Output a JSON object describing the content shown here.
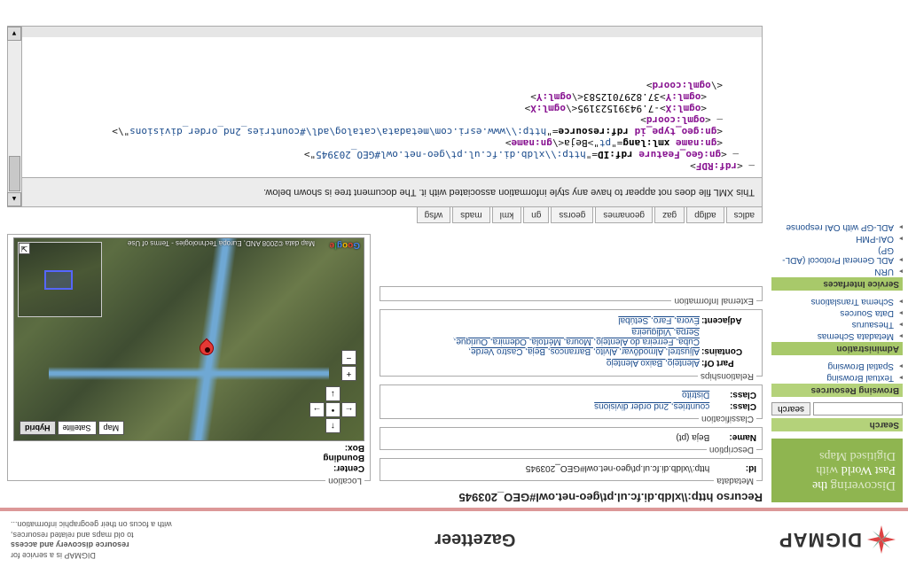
{
  "header": {
    "logo_text": "DIGMAP",
    "title": "Gazetteer",
    "tagline1": "DIGMAP is a service for",
    "tagline2_bold": "resource discovery and access",
    "tagline3": "to old maps and related resources,",
    "tagline4": "with a focus on their geographic information..."
  },
  "promo": {
    "line1a": "Discovering",
    "line1b": " the",
    "line2a": "Past World",
    "line2b": " with",
    "line3": "Digitised Maps"
  },
  "sidebar": {
    "search": {
      "title": "Search",
      "button": "search",
      "placeholder": ""
    },
    "browsing": {
      "title": "Browsing Resources",
      "items": [
        "Textual Browsing",
        "Spatial Browsing"
      ]
    },
    "admin": {
      "title": "Administration",
      "items": [
        "Metadata Schemas",
        "Thesaurus",
        "Data Sources",
        "Schema Translations"
      ]
    },
    "services": {
      "title": "Service Interfaces",
      "items": [
        "URN",
        "ADL General Protocol (ADL-GP)",
        "OAI-PMH",
        "ADL-GP with OAI response"
      ]
    }
  },
  "recurso": {
    "label": "Recurso",
    "uri": "http:\\\\xldb.di.fc.ul.pt\\geo-net.owl#GEO_203945"
  },
  "metadata": {
    "legend": "Metadata",
    "id_label": "Id:",
    "id_value": "http:\\\\xldb.di.fc.ul.pt\\geo-net.owl#GEO_203945"
  },
  "description": {
    "legend": "Description",
    "name_label": "Name:",
    "name_value": "Beja (pt)"
  },
  "classification": {
    "legend": "Classification",
    "class_label": "Class:",
    "class_link": "countries, 2nd order divisions",
    "class2_label": "Class:",
    "class2_link": "Distrito"
  },
  "relationships": {
    "legend": "Relationships",
    "partof_label": "Part Of:",
    "partof_links": "Alentejo, Baixo Alentejo",
    "contains_label": "Contains:",
    "contains_line1": "Aljustrel, Almodôvar, Alvito, Barrancos, Beja, Castro Verde,",
    "contains_line2": "Cuba, Ferreira do Alentejo, Moura, Mértola, Odemira, Ourique,",
    "contains_line3": "Serpa, Vidigueira",
    "adjacent_label": "Adjacent:",
    "adjacent_links": "Évora, Faro, Setúbal"
  },
  "external": {
    "legend": "External Information"
  },
  "location": {
    "legend": "Location",
    "center_label": "Center:",
    "bbox_label": "Bounding Box:",
    "map_types": {
      "map": "Map",
      "satellite": "Satellite",
      "hybrid": "Hybrid"
    },
    "attrib": "Map data ©2008 AND, Europa Technologies - Terms of Use"
  },
  "tabs": [
    "adlcs",
    "adlgp",
    "gaz",
    "geonames",
    "georss",
    "gn",
    "kml",
    "mads",
    "wfsg"
  ],
  "xml": {
    "notice": "This XML file does not appear to have any style information associated with it. The document tree is shown below.",
    "rdf_open": "rdf:RDF",
    "feature_tag": "gn:Geo_Feature",
    "rdfid_attr": "rdf:ID",
    "rdfid_val": "http:\\\\xldb.di.fc.ul.pt\\geo-net.owl#GEO_203945",
    "name_tag": "gn:name",
    "xmllang_attr": "xml:lang",
    "xmllang_val": "pt",
    "name_text": "Beja",
    "geotype_tag": "gn:geo_type_id",
    "resource_attr": "rdf:resource",
    "resource_val": "http:\\\\www.esri.com\\metadata\\catalog\\adl\\#countries_2nd_order_divisions",
    "coord_tag": "ogml:coord",
    "x_tag": "ogml:X",
    "x_val": "-7.94391523195",
    "y_tag": "ogml:Y",
    "y_val": "37.8297012583"
  }
}
